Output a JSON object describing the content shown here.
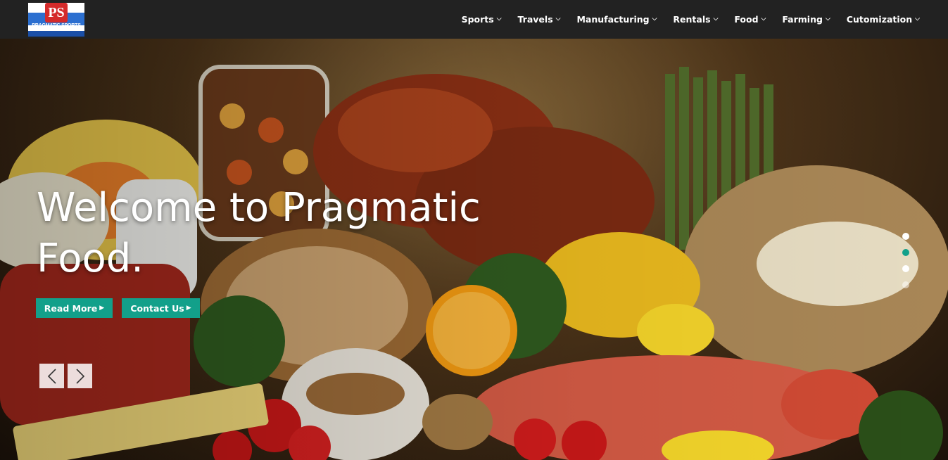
{
  "logo": {
    "mark": "PS",
    "text": "PRAGMATIC SPORTS"
  },
  "nav": {
    "items": [
      {
        "label": "Sports"
      },
      {
        "label": "Travels"
      },
      {
        "label": "Manufacturing"
      },
      {
        "label": "Rentals"
      },
      {
        "label": "Food"
      },
      {
        "label": "Farming"
      },
      {
        "label": "Cutomization"
      }
    ]
  },
  "hero": {
    "title_line1": "Welcome to Pragmatic",
    "title_line2": "Food.",
    "read_more": "Read More",
    "contact_us": "Contact Us",
    "active_slide": 2,
    "slide_count": 4
  },
  "colors": {
    "header_bg": "#222222",
    "accent": "#12a08a",
    "dot_active": "#12a08a",
    "dot_inactive": "#ffffff"
  },
  "icons": {
    "chevron": "chevron-down-icon",
    "caret": "caret-right-icon",
    "prev": "arrow-left-icon",
    "next": "arrow-right-icon"
  }
}
